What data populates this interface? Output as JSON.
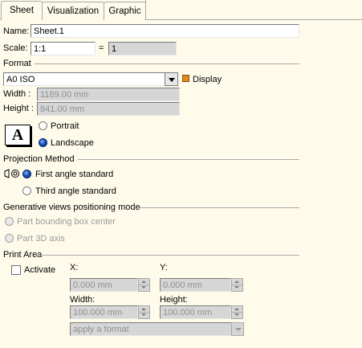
{
  "tabs": [
    {
      "label": "Sheet",
      "active": true
    },
    {
      "label": "Visualization",
      "active": false
    },
    {
      "label": "Graphic",
      "active": false
    }
  ],
  "name": {
    "label": "Name:",
    "value": "Sheet.1"
  },
  "scale": {
    "label": "Scale:",
    "value": "1:1",
    "equals": "=",
    "computed": "1"
  },
  "format": {
    "section": "Format",
    "selected": "A0 ISO",
    "display_label": "Display",
    "width_label": "Width :",
    "width_value": "1189.00 mm",
    "height_label": "Height :",
    "height_value": "841.00 mm",
    "orientation_icon": "A",
    "portrait_label": "Portrait",
    "landscape_label": "Landscape",
    "orientation": "Landscape"
  },
  "projection": {
    "section": "Projection Method",
    "first_label": "First angle standard",
    "third_label": "Third angle standard",
    "selected": "First angle standard"
  },
  "generative": {
    "section": "Generative views positioning mode",
    "opt1": "Part bounding box center",
    "opt2": "Part 3D axis"
  },
  "print_area": {
    "section": "Print Area",
    "activate_label": "Activate",
    "x_label": "X:",
    "x_value": "0.000 mm",
    "y_label": "Y:",
    "y_value": "0.000 mm",
    "width_label": "Width:",
    "width_value": "100.000 mm",
    "height_label": "Height:",
    "height_value": "100.000 mm",
    "format_placeholder": "apply a format"
  },
  "colors": {
    "background": "#fffbea",
    "accent": "#1a4fb8",
    "display_icon": "#e08a1e"
  }
}
